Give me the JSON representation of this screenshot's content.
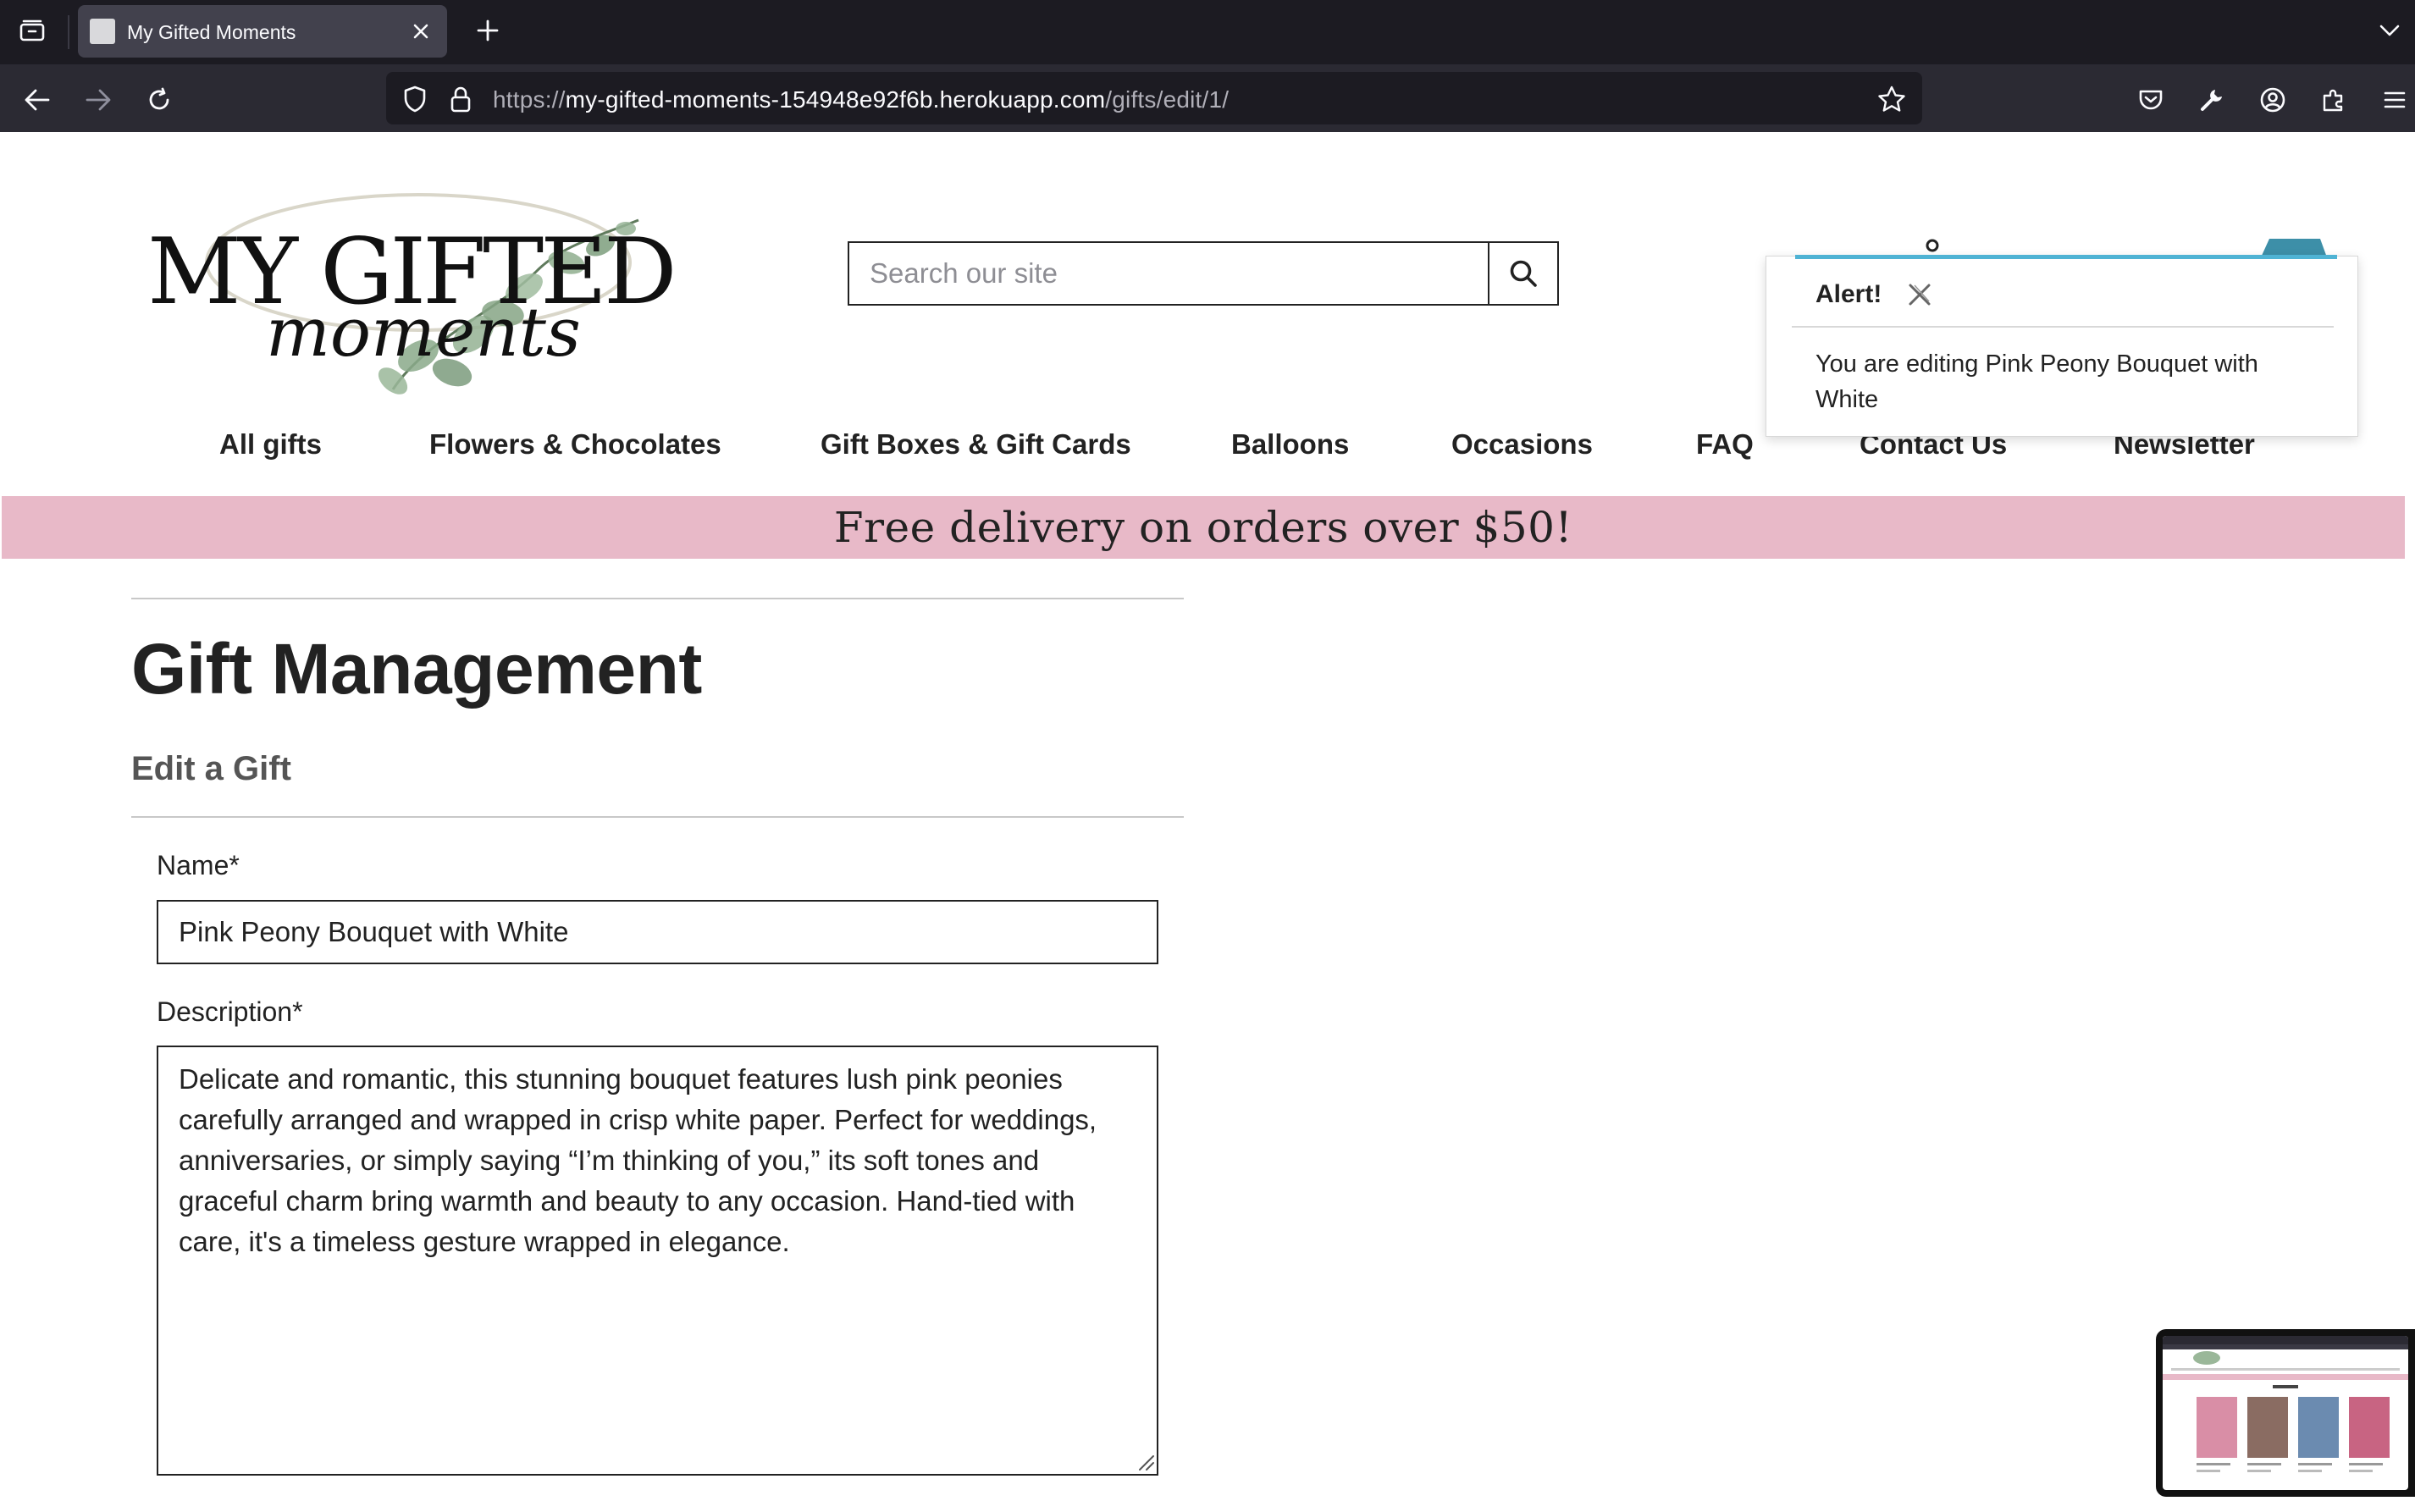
{
  "browser": {
    "tab_title": "My Gifted Moments",
    "url_prefix": "https://",
    "url_host": "my-gifted-moments-154948e92f6b.herokuapp.com",
    "url_path": "/gifts/edit/1/"
  },
  "header": {
    "logo_text_main": "MY GIFTED",
    "logo_text_script": "moments",
    "search_placeholder": "Search our site"
  },
  "menu": {
    "items": [
      "All gifts",
      "Flowers & Chocolates",
      "Gift Boxes & Gift Cards",
      "Balloons",
      "Occasions",
      "FAQ",
      "Contact Us",
      "Newsletter"
    ]
  },
  "banner": {
    "text": "Free delivery on orders over $50!"
  },
  "main": {
    "title": "Gift Management",
    "subtitle": "Edit a Gift",
    "name_label": "Name*",
    "name_value": "Pink Peony Bouquet with White",
    "description_label": "Description*",
    "description_value": "Delicate and romantic, this stunning bouquet features lush pink peonies carefully arranged and wrapped in crisp white paper. Perfect for weddings, anniversaries, or simply saying “I’m thinking of you,” its soft tones and graceful charm bring warmth and beauty to any occasion. Hand-tied with care, it's a timeless gesture wrapped in elegance."
  },
  "toast": {
    "title": "Alert!",
    "message": "You are editing Pink Peony Bouquet with White"
  },
  "colors": {
    "banner": "#e8b9c8",
    "toast_accent": "#4fb3d4",
    "chrome_dark": "#1c1b22",
    "chrome_toolbar": "#2b2a33"
  }
}
